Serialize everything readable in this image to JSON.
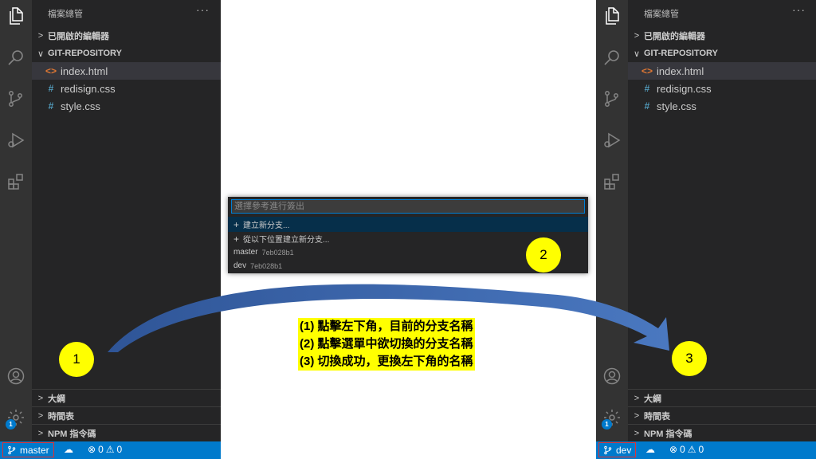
{
  "sidebar": {
    "title": "檔案總管",
    "more": "···",
    "open_editors": "已開啟的編輯器",
    "repo": "GIT-REPOSITORY",
    "files": [
      {
        "icon": "<>",
        "name": "index.html"
      },
      {
        "icon": "#",
        "name": "redisign.css"
      },
      {
        "icon": "#",
        "name": "style.css"
      }
    ],
    "bottom_sections": [
      "大綱",
      "時間表",
      "NPM 指令碼"
    ]
  },
  "activity_badge": "1",
  "status_left": {
    "branch": "master",
    "errors": "0",
    "warnings": "0"
  },
  "status_right": {
    "branch": "dev",
    "errors": "0",
    "warnings": "0"
  },
  "quick_pick": {
    "placeholder": "選擇參考進行簽出",
    "items": [
      {
        "label": "建立新分支..."
      },
      {
        "label": "從以下位置建立新分支..."
      },
      {
        "label": "master",
        "hash": "7eb028b1"
      },
      {
        "label": "dev",
        "hash": "7eb028b1"
      }
    ]
  },
  "steps": [
    "1",
    "2",
    "3"
  ],
  "notes": [
    "(1) 點擊左下角，目前的分支名稱",
    "(2) 點擊選單中欲切換的分支名稱",
    "(3) 切換成功，更換左下角的名稱"
  ],
  "colors": {
    "activity_bar": "#333333",
    "sidebar": "#252526",
    "status_bar": "#007acc",
    "highlight": "#ffff00",
    "arrow": "#3a64b0",
    "branch_box": "#e03030"
  }
}
